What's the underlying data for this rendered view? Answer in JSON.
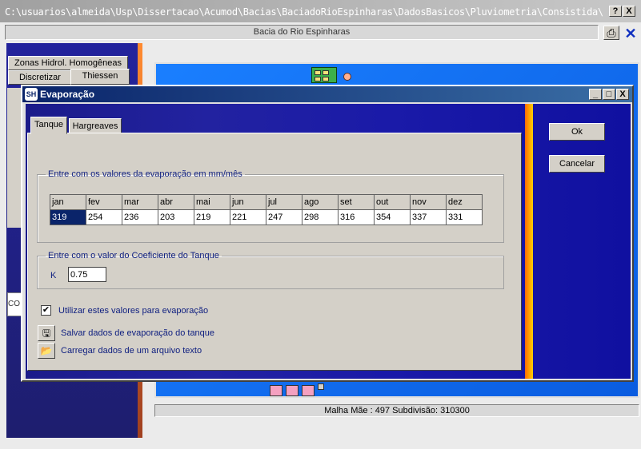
{
  "window": {
    "title": "C:\\usuarios\\almeida\\Usp\\Dissertacao\\Acumod\\Bacias\\BaciadoRioEspinharas\\DadosBasicos\\Pluviometria\\Consistida\\",
    "help_button": "?",
    "close_button": "X"
  },
  "basin_name": "Bacia do Rio Espinharas",
  "left_panel": {
    "tab_top": "Zonas Hidrol. Homogêneas",
    "tab_discretize": "Discretizar",
    "tab_thiessen": "Thiessen",
    "input_fragment": "CO"
  },
  "map_footer": "Malha Mãe : 497   Subdivisão: 310300",
  "dialog": {
    "title": "Evaporação",
    "min_button": "_",
    "max_button": "□",
    "close_button": "X",
    "tabs": [
      {
        "label": "Tanque",
        "active": true
      },
      {
        "label": "Hargreaves",
        "active": false
      }
    ],
    "ok_label": "Ok",
    "cancel_label": "Cancelar",
    "evap_group_label": "Entre com os valores da evaporação em mm/mês",
    "months": [
      "jan",
      "fev",
      "mar",
      "abr",
      "mai",
      "jun",
      "jul",
      "ago",
      "set",
      "out",
      "nov",
      "dez"
    ],
    "values": [
      "319",
      "254",
      "236",
      "203",
      "219",
      "221",
      "247",
      "298",
      "316",
      "354",
      "337",
      "331"
    ],
    "coef_group_label": "Entre com o valor do Coeficiente do Tanque",
    "k_label": "K",
    "k_value": "0.75",
    "use_values_label": "Utilizar estes valores para evaporação",
    "use_values_checked": true,
    "save_label": "Salvar dados de evaporação do tanque",
    "load_label": "Carregar dados de um arquivo texto"
  },
  "colors": {
    "dialog_title": "#0a246a",
    "map_blue": "#1a7fff",
    "label_blue": "#102080"
  },
  "icons": {
    "print": "printer-icon",
    "save": "floppy-disk-icon",
    "load": "folder-open-icon",
    "app": "app-logo-icon"
  }
}
